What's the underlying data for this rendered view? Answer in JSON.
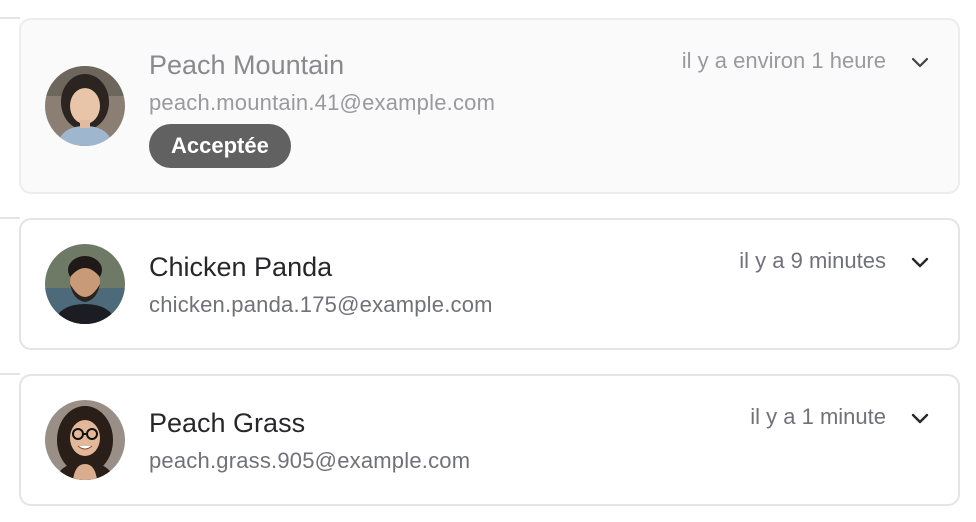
{
  "invitations": [
    {
      "name": "Peach Mountain",
      "email": "peach.mountain.41@example.com",
      "time": "il y a environ 1 heure",
      "status": "Acceptée",
      "avatar": "woman-avatar"
    },
    {
      "name": "Chicken Panda",
      "email": "chicken.panda.175@example.com",
      "time": "il y a 9 minutes",
      "avatar": "man-avatar"
    },
    {
      "name": "Peach Grass",
      "email": "peach.grass.905@example.com",
      "time": "il y a 1 minute",
      "avatar": "woman-glasses-avatar"
    }
  ],
  "icons": {
    "expand": "chevron-down-icon"
  },
  "colors": {
    "badge_bg": "#616161",
    "border": "#e4e4e7",
    "muted_card_bg": "#fafafa"
  }
}
